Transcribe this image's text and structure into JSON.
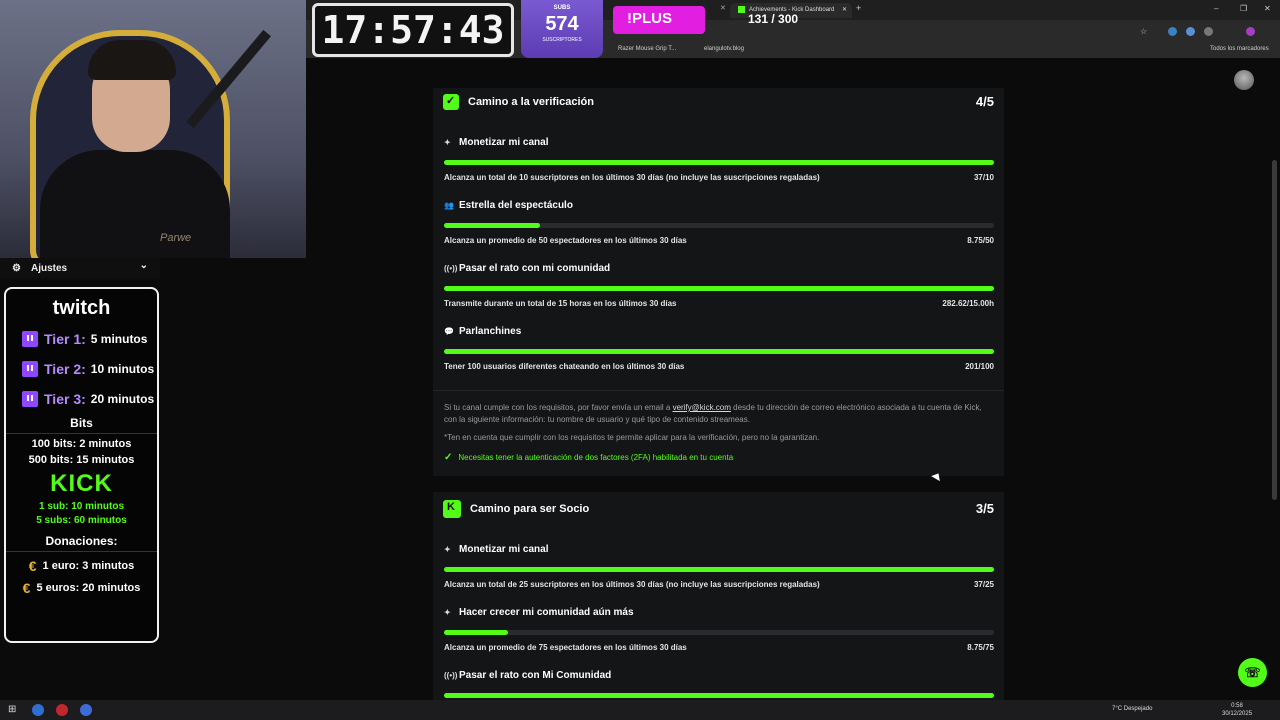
{
  "browser": {
    "tabs": [
      {
        "label": "Achievements - Kick Dashboard"
      }
    ],
    "bookmarks": [
      "Razer Mouse Grip T...",
      "elangulotv.blog",
      "Todos los marcadores"
    ],
    "new_tab": "+",
    "window_controls": [
      "–",
      "❐",
      "✕"
    ]
  },
  "overlay": {
    "clock": "17:57:43",
    "subs_title": "SUBS",
    "subs_count": "574",
    "subs_sub": "SUSCRIPTORES",
    "plus": "!PLUS",
    "goal": "131 / 300"
  },
  "sidebar": {
    "settings_label": "Ajustes",
    "twitch_logo": "twitch",
    "tiers": [
      {
        "label": "Tier 1:",
        "value": "5 minutos"
      },
      {
        "label": "Tier 2:",
        "value": "10 minutos"
      },
      {
        "label": "Tier 3:",
        "value": "20 minutos"
      }
    ],
    "bits_title": "Bits",
    "bits": [
      "100 bits: 2 minutos",
      "500 bits: 15 minutos"
    ],
    "kick_logo": "KICK",
    "kick_lines": [
      "1 sub: 10 minutos",
      "5 subs: 60 minutos"
    ],
    "donations_title": "Donaciones:",
    "donations": [
      "1 euro: 3 minutos",
      "5 euros: 20 minutos"
    ],
    "webcam_tag": "Parwe"
  },
  "verification": {
    "title": "Camino a la verificación",
    "score": "4/5",
    "items": [
      {
        "icon": "sparkle",
        "title": "Monetizar mi canal",
        "desc": "Alcanza un total de 10 suscriptores en los últimos 30 días (no incluye las suscripciones regaladas)",
        "value": "37/10",
        "progress": 1.0
      },
      {
        "icon": "users",
        "title": "Estrella del espectáculo",
        "desc": "Alcanza un promedio de 50 espectadores en los últimos 30 días",
        "value": "8.75/50",
        "progress": 0.175
      },
      {
        "icon": "broadcast",
        "title": "Pasar el rato con mi comunidad",
        "desc": "Transmite durante un total de 15 horas en los últimos 30 días",
        "value": "282.62/15.00h",
        "progress": 1.0
      },
      {
        "icon": "chat",
        "title": "Parlanchines",
        "desc": "Tener 100 usuarios diferentes chateando en los últimos 30 días",
        "value": "201/100",
        "progress": 1.0
      }
    ],
    "info_prefix": "Si tu canal cumple con los requisitos, por favor envía un email a ",
    "info_email": "verify@kick.com",
    "info_suffix": " desde tu dirección de correo electrónico asociada a tu cuenta de Kick, con la siguiente información: tu nombre de usuario y qué tipo de contenido streameas.",
    "note": "*Ten en cuenta que cumplir con los requisitos te permite aplicar para la verificación, pero no la garantizan.",
    "twofa": "Necesitas tener la autenticación de dos factores (2FA) habilitada en tu cuenta"
  },
  "partner": {
    "title": "Camino para ser Socio",
    "score": "3/5",
    "items": [
      {
        "icon": "sparkle",
        "title": "Monetizar mi canal",
        "desc": "Alcanza un total de 25 suscriptores en los últimos 30 días (no incluye las suscripciones regaladas)",
        "value": "37/25",
        "progress": 1.0
      },
      {
        "icon": "sparkle",
        "title": "Hacer crecer mi comunidad aún más",
        "desc": "Alcanza un promedio de 75 espectadores en los últimos 30 días",
        "value": "8.75/75",
        "progress": 0.117
      },
      {
        "icon": "broadcast",
        "title": "Pasar el rato con Mi Comunidad",
        "desc": "",
        "value": "",
        "progress": 1.0
      }
    ]
  },
  "taskbar": {
    "weather": "7°C  Despejado",
    "time": "0:58",
    "date": "30/12/2025"
  },
  "colors": {
    "kick_green": "#53fc18",
    "twitch_purple": "#9146ff",
    "plus_magenta": "#e21fe0",
    "subs_purple": "#6f4dc8"
  }
}
